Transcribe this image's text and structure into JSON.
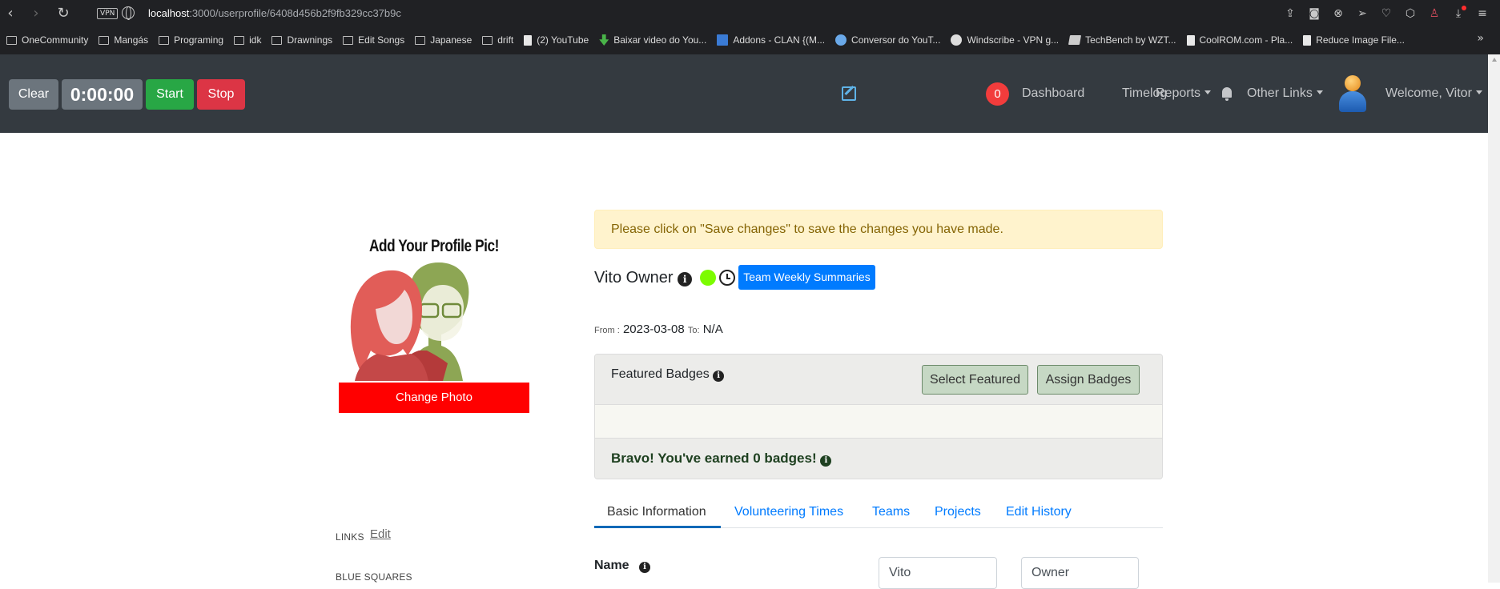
{
  "browser": {
    "url_host": "localhost",
    "url_path": ":3000/userprofile/6408d456b2f9fb329cc37b9c",
    "vpn_badge": "VPN",
    "bookmarks": [
      {
        "label": "OneCommunity",
        "icon": "folder-icon"
      },
      {
        "label": "Mangás",
        "icon": "folder-icon"
      },
      {
        "label": "Programing",
        "icon": "folder-icon"
      },
      {
        "label": "idk",
        "icon": "folder-icon"
      },
      {
        "label": "Drawnings",
        "icon": "folder-icon"
      },
      {
        "label": "Edit Songs",
        "icon": "folder-icon"
      },
      {
        "label": "Japanese",
        "icon": "folder-icon"
      },
      {
        "label": "drift",
        "icon": "folder-icon"
      },
      {
        "label": "(2) YouTube",
        "icon": "file-icon"
      },
      {
        "label": "Baixar video do You...",
        "icon": "download-icon"
      },
      {
        "label": "Addons - CLAN {(M...",
        "icon": "site-icon"
      },
      {
        "label": "Conversor do YouT...",
        "icon": "converter-icon"
      },
      {
        "label": "Windscribe - VPN g...",
        "icon": "windscribe-icon"
      },
      {
        "label": "TechBench by WZT...",
        "icon": "windows-icon"
      },
      {
        "label": "CoolROM.com - Pla...",
        "icon": "file-icon"
      },
      {
        "label": "Reduce Image File...",
        "icon": "file-icon"
      }
    ],
    "more": "»"
  },
  "timer": {
    "clear_label": "Clear",
    "time": "0:00:00",
    "start_label": "Start",
    "stop_label": "Stop"
  },
  "nav": {
    "notification_count": "0",
    "dashboard": "Dashboard",
    "timelog": "Timelog",
    "reports": "Reports",
    "other_links": "Other Links",
    "welcome": "Welcome, Vitor"
  },
  "sidebar": {
    "pic_title": "Add Your Profile Pic!",
    "change_photo": "Change Photo",
    "links_label": "LINKS",
    "links_edit": "Edit",
    "blue_squares_label": "BLUE SQUARES"
  },
  "profile": {
    "alert": "Please click on \"Save changes\" to save the changes you have made.",
    "name": "Vito Owner",
    "team_weekly_summaries": "Team Weekly Summaries",
    "from_label": "From :",
    "from_date": "2023-03-08",
    "to_label": "To:",
    "to_date": "N/A",
    "status_color": "#7cfc00"
  },
  "badges": {
    "title": "Featured Badges",
    "select_featured": "Select Featured",
    "assign_badges": "Assign Badges",
    "earned": "Bravo! You've earned 0 badges!"
  },
  "tabs": [
    {
      "label": "Basic Information",
      "active": true
    },
    {
      "label": "Volunteering Times",
      "active": false
    },
    {
      "label": "Teams",
      "active": false
    },
    {
      "label": "Projects",
      "active": false
    },
    {
      "label": "Edit History",
      "active": false
    }
  ],
  "basic_info": {
    "name_label": "Name",
    "first_name": "Vito",
    "last_name": "Owner"
  }
}
